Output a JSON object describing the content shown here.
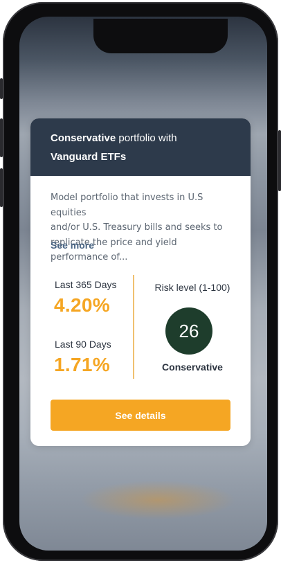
{
  "card": {
    "title_bold": "Conservative",
    "title_rest": " portfolio with",
    "title_line2": "Vanguard ETFs",
    "description_lines": [
      "Model portfolio that invests in U.S equities",
      "and/or U.S. Treasury bills and seeks to",
      "replicate the price and yield performance of..."
    ],
    "see_more": "See more",
    "stats": [
      {
        "label": "Last 365 Days",
        "value": "4.20%"
      },
      {
        "label": "Last 90 Days",
        "value": "1.71%"
      }
    ],
    "risk": {
      "label": "Risk level (1-100)",
      "value": "26",
      "level_name": "Conservative"
    },
    "button_label": "See details"
  },
  "colors": {
    "header_bg": "#2d3a4b",
    "accent": "#f5a623",
    "risk_circle": "#1e3d2c",
    "link": "#4a6584"
  }
}
